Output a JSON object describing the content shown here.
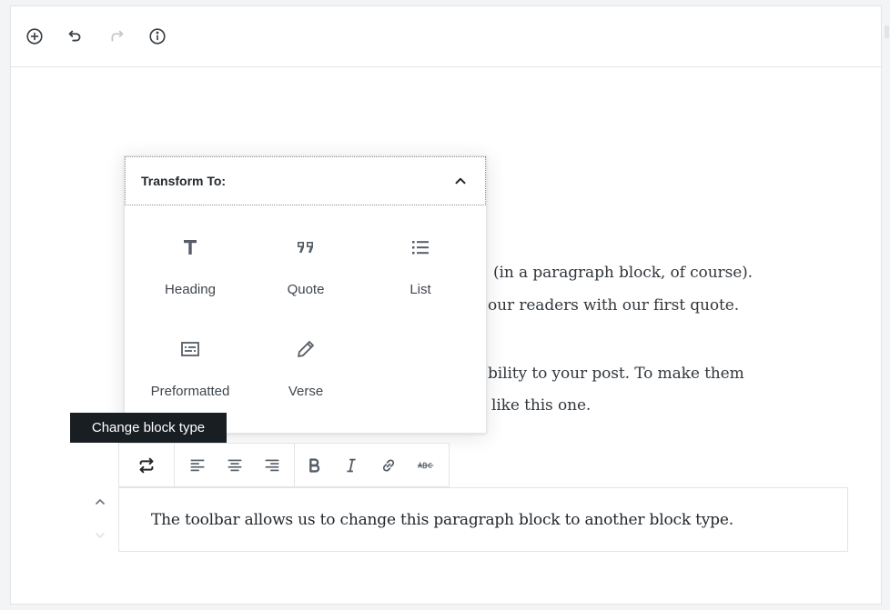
{
  "top_toolbar": {
    "icons": [
      "add-block-icon",
      "undo-icon",
      "redo-icon",
      "info-icon"
    ]
  },
  "background_text": {
    "line1": "(in a paragraph block, of course).",
    "line2": "our readers with our first quote.",
    "line3": "bility to your post. To make them",
    "line4": "like this one."
  },
  "popover": {
    "title": "Transform To:",
    "items": [
      {
        "label": "Heading",
        "icon": "heading-icon"
      },
      {
        "label": "Quote",
        "icon": "quote-icon"
      },
      {
        "label": "List",
        "icon": "list-icon"
      },
      {
        "label": "Preformatted",
        "icon": "preformatted-icon"
      },
      {
        "label": "Verse",
        "icon": "verse-icon"
      }
    ]
  },
  "tooltip": {
    "text": "Change block type"
  },
  "block_toolbar": {
    "icons": [
      "change-block-type-icon",
      "align-left-icon",
      "align-center-icon",
      "align-right-icon",
      "bold-icon",
      "italic-icon",
      "link-icon",
      "strikethrough-icon"
    ]
  },
  "paragraph": {
    "text": "The toolbar allows us to change this paragraph block to another block type."
  },
  "colors": {
    "text": "#23282d",
    "border": "#e2e4e7",
    "tooltip_bg": "#191e23",
    "icon": "#555d66",
    "icon_disabled": "#c4c7cb"
  }
}
